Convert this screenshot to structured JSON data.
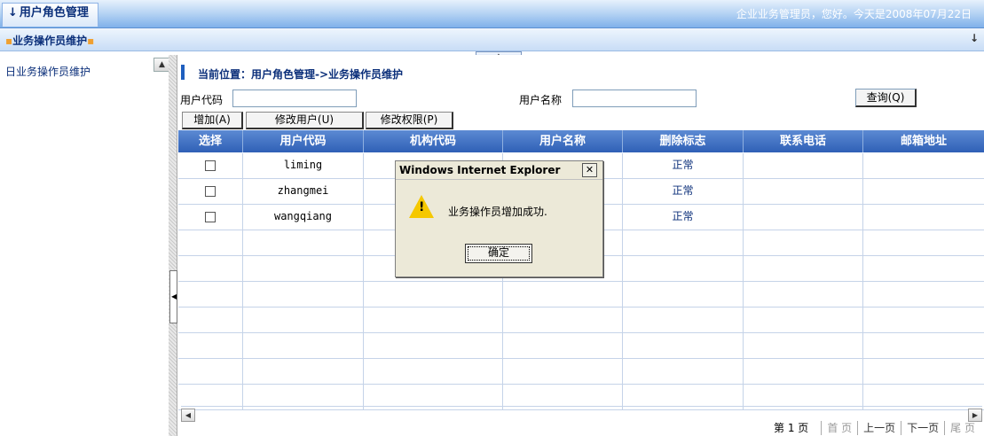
{
  "header": {
    "module_tab": "用户角色管理",
    "greeting": "企业业务管理员，您好。今天是2008年07月22日"
  },
  "subbar": {
    "crumb": "业务操作员维护"
  },
  "sidebar": {
    "items": [
      {
        "label": "日业务操作员维护"
      }
    ]
  },
  "location": {
    "text": "当前位置：用户角色管理->业务操作员维护"
  },
  "filter": {
    "user_code_label": "用户代码",
    "user_name_label": "用户名称",
    "query_button": "查询(Q)"
  },
  "actions": {
    "add": "增加(A)",
    "modify_user": "修改用户(U)",
    "modify_permission": "修改权限(P)"
  },
  "table": {
    "headers": [
      "选择",
      "用户代码",
      "机构代码",
      "用户名称",
      "删除标志",
      "联系电话",
      "邮箱地址"
    ],
    "rows": [
      {
        "user_code": "liming",
        "org_code": "",
        "user_name": "",
        "delete_flag": "正常",
        "phone": "",
        "email": ""
      },
      {
        "user_code": "zhangmei",
        "org_code": "",
        "user_name": "",
        "delete_flag": "正常",
        "phone": "",
        "email": ""
      },
      {
        "user_code": "wangqiang",
        "org_code": "",
        "user_name": "",
        "delete_flag": "正常",
        "phone": "",
        "email": ""
      }
    ]
  },
  "pager": {
    "page_text": "第 1 页",
    "first": "首 页",
    "prev": "上一页",
    "next": "下一页",
    "last": "尾 页"
  },
  "dialog": {
    "title": "Windows Internet Explorer",
    "message": "业务操作员增加成功.",
    "ok_button": "确定"
  },
  "icons": {
    "warning": "warning-icon",
    "close": "close-icon"
  },
  "colors": {
    "header_blue": "#2f60b6",
    "link_blue": "#0b2f7a",
    "warning_yellow": "#f5c800"
  }
}
